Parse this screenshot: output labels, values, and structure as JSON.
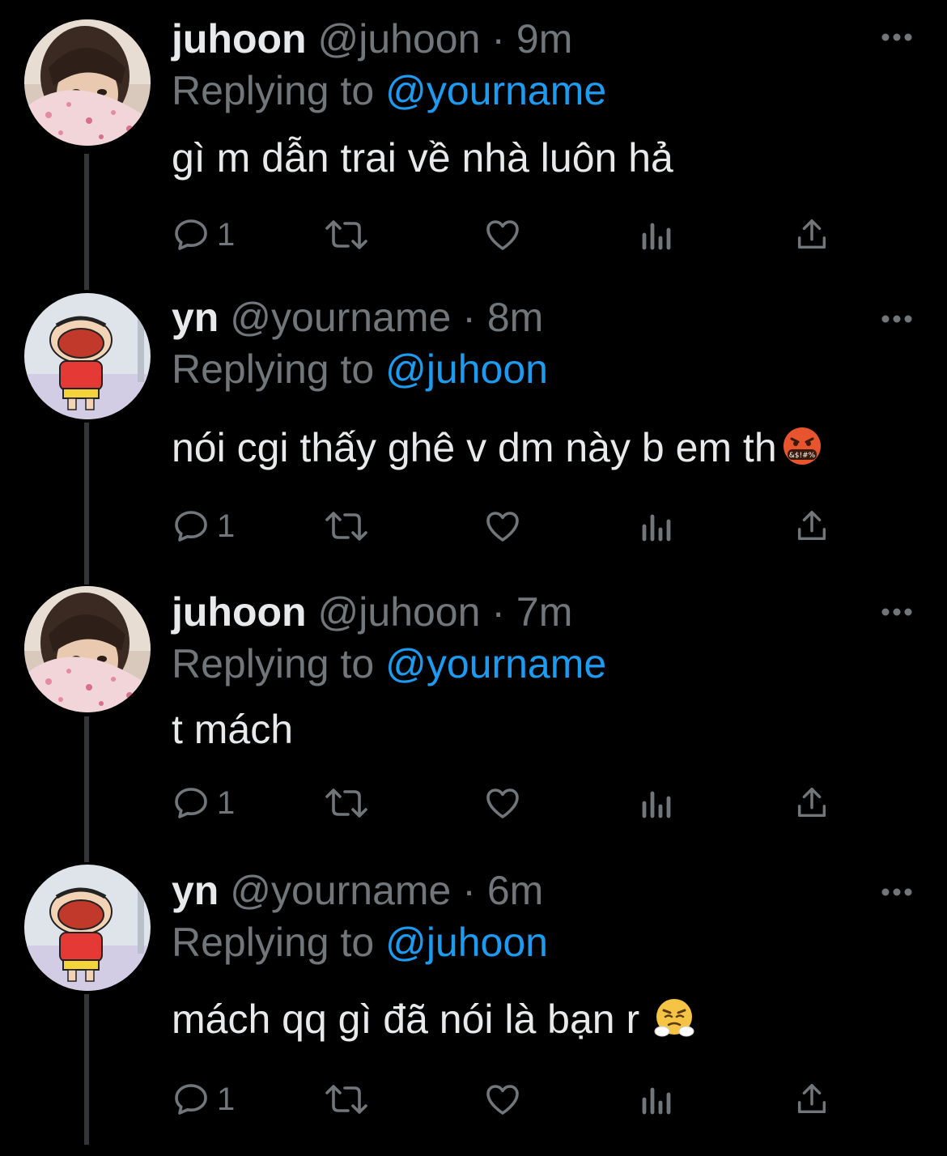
{
  "tweets": [
    {
      "avatar": "juhoon-photo-avatar",
      "name": "juhoon",
      "handle": "@juhoon",
      "dot": "·",
      "time": "9m",
      "reply_prefix": "Replying to",
      "reply_to": "@yourname",
      "text": "gì m dẫn trai về nhà luôn hả",
      "emoji": "",
      "reply_count": "1"
    },
    {
      "avatar": "shinchan-cartoon-avatar",
      "name": "yn",
      "handle": "@yourname",
      "dot": "·",
      "time": "8m",
      "reply_prefix": "Replying to",
      "reply_to": "@juhoon",
      "text": "nói cgi thấy ghê v dm này b em th",
      "emoji": "face-with-symbols-on-mouth",
      "reply_count": "1"
    },
    {
      "avatar": "juhoon-photo-avatar",
      "name": "juhoon",
      "handle": "@juhoon",
      "dot": "·",
      "time": "7m",
      "reply_prefix": "Replying to",
      "reply_to": "@yourname",
      "text": "t mách",
      "emoji": "",
      "reply_count": "1"
    },
    {
      "avatar": "shinchan-cartoon-avatar",
      "name": "yn",
      "handle": "@yourname",
      "dot": "·",
      "time": "6m",
      "reply_prefix": "Replying to",
      "reply_to": "@juhoon",
      "text": "mách qq gì đã nói là bạn r",
      "emoji": "face-with-steam-from-nose",
      "reply_count": "1"
    }
  ],
  "icons": {
    "reply": "reply-icon",
    "retweet": "retweet-icon",
    "like": "heart-icon",
    "views": "views-icon",
    "share": "share-icon",
    "more": "more-icon"
  },
  "colors": {
    "background": "#000000",
    "name": "#e7e9ea",
    "muted": "#71767b",
    "link": "#1d9bf0",
    "thread_line": "#333639"
  }
}
